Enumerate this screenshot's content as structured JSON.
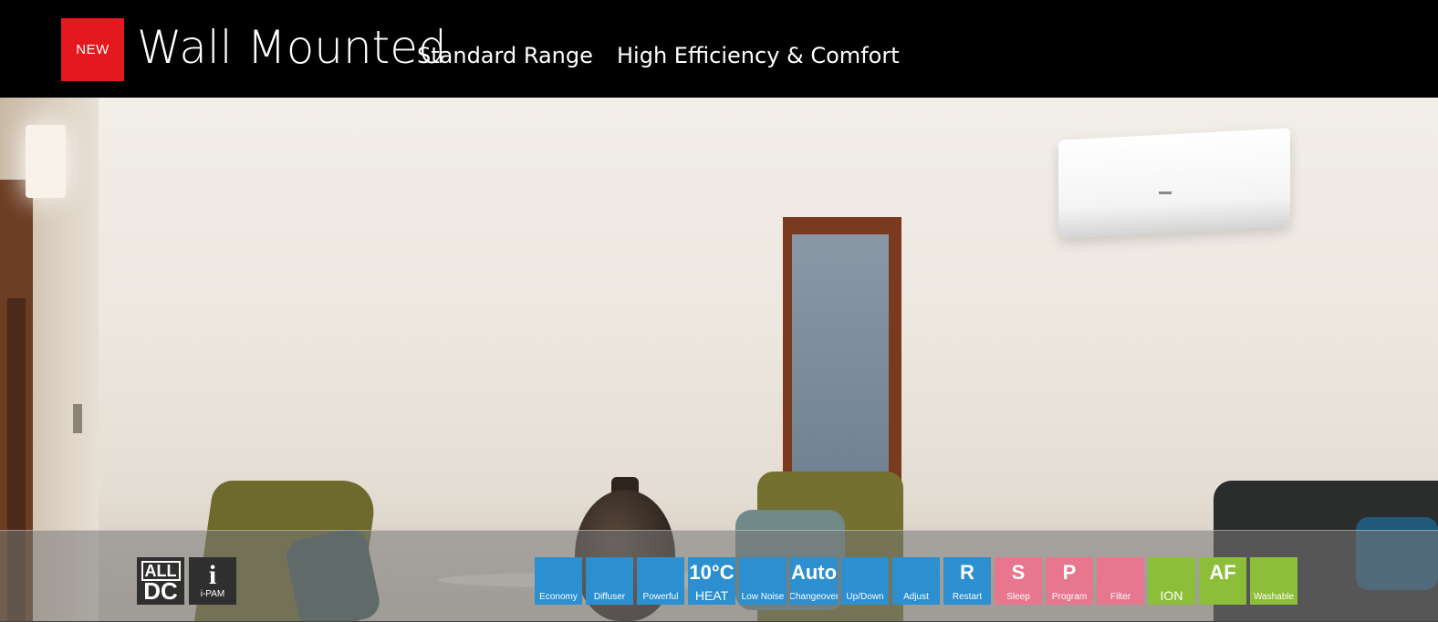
{
  "header": {
    "badge": "NEW",
    "title": "Wall Mounted",
    "subtitle": "Standard Range",
    "tagline": "High Efficiency & Comfort"
  },
  "badges": {
    "all_dc_top": "ALL",
    "all_dc_bottom": "DC",
    "ipam_letter": "i",
    "ipam_label": "i-PAM"
  },
  "features": [
    {
      "label": "Economy",
      "glyph": "",
      "color": "#2b8fd0"
    },
    {
      "label": "Diffuser",
      "glyph": "",
      "color": "#2b8fd0"
    },
    {
      "label": "Powerful",
      "glyph": "",
      "color": "#2b8fd0"
    },
    {
      "label": "HEAT",
      "glyph": "10°C",
      "color": "#2b8fd0"
    },
    {
      "label": "Low Noise",
      "glyph": "",
      "color": "#2b8fd0"
    },
    {
      "label": "Changeover",
      "glyph": "Auto",
      "color": "#2b8fd0"
    },
    {
      "label": "Up/Down",
      "glyph": "",
      "color": "#2b8fd0"
    },
    {
      "label": "Adjust",
      "glyph": "",
      "color": "#2b8fd0"
    },
    {
      "label": "Restart",
      "glyph": "R",
      "color": "#2b8fd0"
    },
    {
      "label": "Sleep",
      "glyph": "S",
      "color": "#e8768f"
    },
    {
      "label": "Program",
      "glyph": "P",
      "color": "#e8768f"
    },
    {
      "label": "Filter",
      "glyph": "",
      "color": "#e8768f"
    },
    {
      "label": "ION",
      "glyph": "",
      "color": "#8dbe3a"
    },
    {
      "label": "",
      "glyph": "AF",
      "color": "#8dbe3a"
    },
    {
      "label": "Washable",
      "glyph": "",
      "color": "#8dbe3a"
    }
  ]
}
